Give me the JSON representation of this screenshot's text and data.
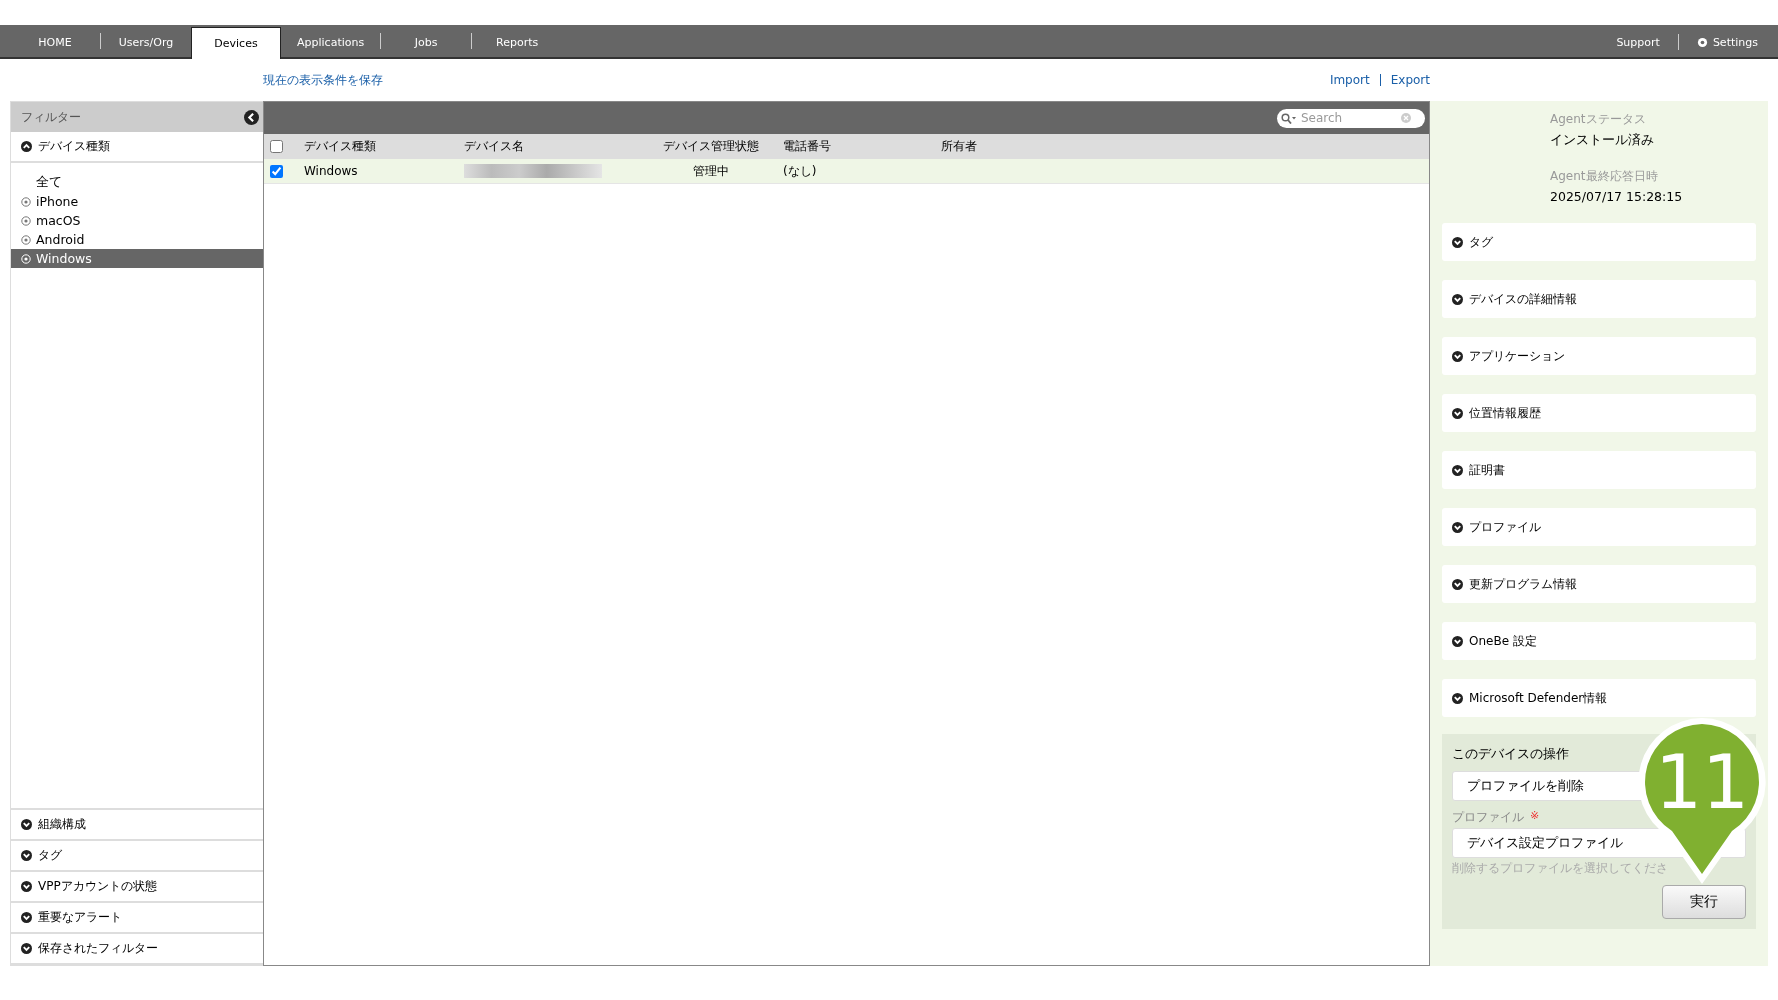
{
  "nav": {
    "tabs": [
      {
        "label": "HOME",
        "selected": false
      },
      {
        "label": "Users/Org",
        "selected": false
      },
      {
        "label": "Devices",
        "selected": true
      },
      {
        "label": "Applications",
        "selected": false
      },
      {
        "label": "Jobs",
        "selected": false
      },
      {
        "label": "Reports",
        "selected": false
      }
    ],
    "right": [
      {
        "label": "Support",
        "kind": "plain"
      },
      {
        "label": "Settings",
        "kind": "gear"
      }
    ]
  },
  "save_link": "現在の表示条件を保存",
  "io_links": [
    "Import",
    "Export"
  ],
  "filter": {
    "title": "フィルター",
    "device_type": {
      "label": "デバイス種類",
      "expanded": true,
      "items": [
        {
          "label": "全て",
          "selected": false,
          "kind": "plain"
        },
        {
          "label": "iPhone",
          "selected": false,
          "kind": "radio"
        },
        {
          "label": "macOS",
          "selected": false,
          "kind": "radio"
        },
        {
          "label": "Android",
          "selected": false,
          "kind": "radio"
        },
        {
          "label": "Windows",
          "selected": true,
          "kind": "radio"
        }
      ]
    },
    "sections": [
      {
        "label": "組織構成",
        "expanded": false
      },
      {
        "label": "タグ",
        "expanded": false
      },
      {
        "label": "VPPアカウントの状態",
        "expanded": false
      },
      {
        "label": "重要なアラート",
        "expanded": false
      },
      {
        "label": "保存されたフィルター",
        "expanded": false
      }
    ]
  },
  "search": {
    "placeholder": "Search"
  },
  "table": {
    "all_checked": false,
    "columns": [
      "デバイス種類",
      "デバイス名",
      "デバイス管理状態",
      "電話番号",
      "所有者"
    ],
    "rows": [
      {
        "checked": true,
        "selected": true,
        "cells": [
          "Windows",
          "",
          "管理中",
          "(なし)",
          ""
        ]
      }
    ]
  },
  "details": {
    "fields": [
      {
        "label": "Agentステータス",
        "value": "インストール済み"
      },
      {
        "label": "Agent最終応答日時",
        "value": "2025/07/17 15:28:15"
      }
    ],
    "sections": [
      {
        "label": "タグ",
        "expanded": false
      },
      {
        "label": "デバイスの詳細情報",
        "expanded": false
      },
      {
        "label": "アプリケーション",
        "expanded": false
      },
      {
        "label": "位置情報履歴",
        "expanded": false
      },
      {
        "label": "証明書",
        "expanded": false
      },
      {
        "label": "プロファイル",
        "expanded": false
      },
      {
        "label": "更新プログラム情報",
        "expanded": false
      },
      {
        "label": "OneBe 設定",
        "expanded": false
      },
      {
        "label": "Microsoft Defender情報",
        "expanded": false
      }
    ],
    "actions": {
      "title": "このデバイスの操作",
      "action_value": "プロファイルを削除",
      "profile_label": "プロファイル",
      "required_mark": "※",
      "profile_value": "デバイス設定プロファイル",
      "hint": "削除するプロファイルを選択してくださ",
      "run_button": "実行"
    }
  },
  "callout": {
    "number": "11"
  }
}
